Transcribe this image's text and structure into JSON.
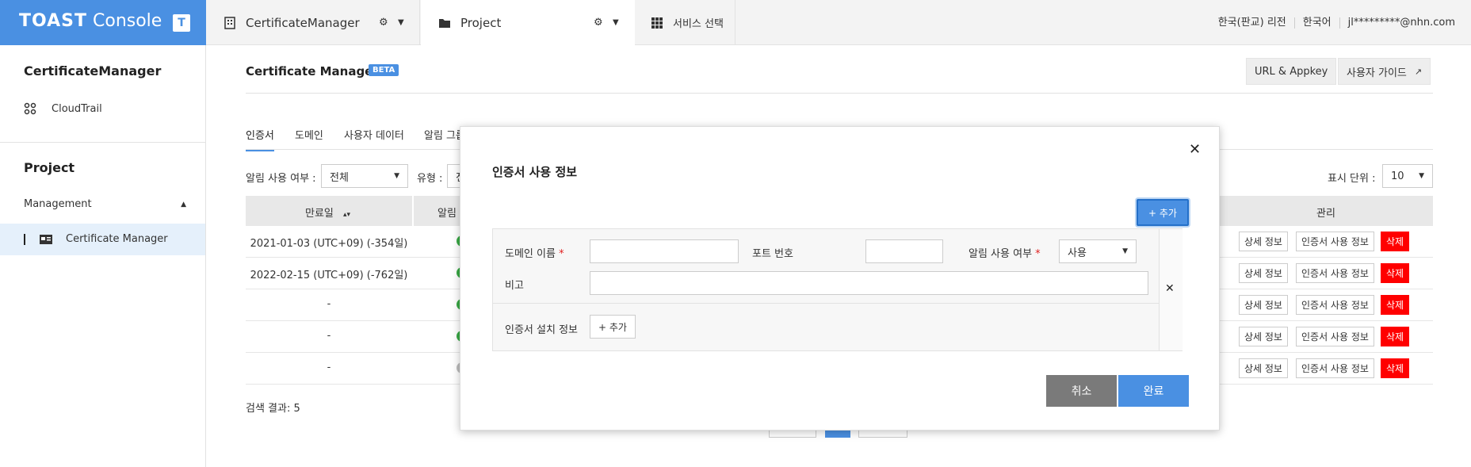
{
  "topbar": {
    "logo_bold": "TOAST",
    "logo_light": " Console",
    "logo_button": "T",
    "tabs": [
      {
        "label": "CertificateManager"
      },
      {
        "label": "Project"
      },
      {
        "label": "서비스 선택"
      }
    ],
    "region": "한국(판교) 리전",
    "language": "한국어",
    "user": "jl*********@nhn.com"
  },
  "sidebar": {
    "org_title": "CertificateManager",
    "org_items": [
      {
        "label": "CloudTrail",
        "icon": "cloudtrail-icon"
      }
    ],
    "project_title": "Project",
    "section": "Management",
    "section_items": [
      {
        "label": "Certificate Manager",
        "icon": "certificate-icon"
      }
    ]
  },
  "header": {
    "title": "Certificate Manager",
    "badge": "BETA",
    "url_appkey": "URL & Appkey",
    "guide": "사용자 가이드"
  },
  "tabs": [
    "인증서",
    "도메인",
    "사용자 데이터",
    "알림 그룹"
  ],
  "filters": {
    "notify_label": "알림 사용 여부 :",
    "notify_value": "전체",
    "type_label": "유형 :",
    "type_value": "전",
    "page_size_label": "표시 단위 :",
    "page_size_value": "10"
  },
  "table": {
    "columns": {
      "expiry": "만료일",
      "notify": "알림",
      "manage": "관리"
    },
    "rows": [
      {
        "expiry": "2021-01-03 (UTC+09) (-354일)",
        "notify": true
      },
      {
        "expiry": "2022-02-15 (UTC+09) (-762일)",
        "notify": true
      },
      {
        "expiry": "-",
        "notify": true
      },
      {
        "expiry": "-",
        "notify": true
      },
      {
        "expiry": "-",
        "notify": false
      }
    ],
    "row_buttons": {
      "detail": "상세 정보",
      "usage": "인증서 사용 정보",
      "delete": "삭제"
    },
    "result_label": "검색 결과: 5"
  },
  "modal": {
    "title": "인증서 사용 정보",
    "add_button": "+ 추가",
    "domain_label": "도메인 이름",
    "port_label": "포트 번호",
    "notify_label": "알림 사용 여부",
    "notify_value": "사용",
    "memo_label": "비고",
    "install_label": "인증서 설치 정보",
    "install_add": "+ 추가",
    "required_mark": "*",
    "cancel": "취소",
    "ok": "완료"
  }
}
